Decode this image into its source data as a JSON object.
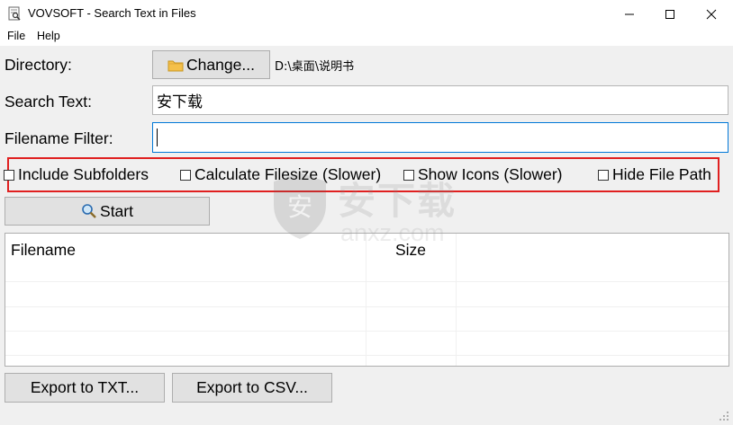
{
  "window": {
    "title": "VOVSOFT - Search Text in Files"
  },
  "menu": [
    "File",
    "Help"
  ],
  "directory": {
    "label": "Directory:",
    "change_button": "Change...",
    "path": "D:\\桌面\\说明书"
  },
  "search_text": {
    "label": "Search Text:",
    "value": "安下载"
  },
  "filename_filter": {
    "label": "Filename Filter:",
    "value": ""
  },
  "options": [
    {
      "label": "Include Subfolders",
      "checked": false
    },
    {
      "label": "Calculate Filesize (Slower)",
      "checked": false
    },
    {
      "label": "Show Icons (Slower)",
      "checked": false
    },
    {
      "label": "Hide File Path",
      "checked": false
    }
  ],
  "start_button": "Start",
  "results": {
    "columns": [
      "Filename",
      "Size"
    ],
    "rows": []
  },
  "export": {
    "txt_button": "Export to TXT...",
    "csv_button": "Export to CSV..."
  },
  "watermark": {
    "text": "安下载",
    "sub": "anxz.com"
  },
  "colors": {
    "highlight_border": "#e02020",
    "focus_border": "#0078d7",
    "window_bg": "#f0f0f0"
  }
}
